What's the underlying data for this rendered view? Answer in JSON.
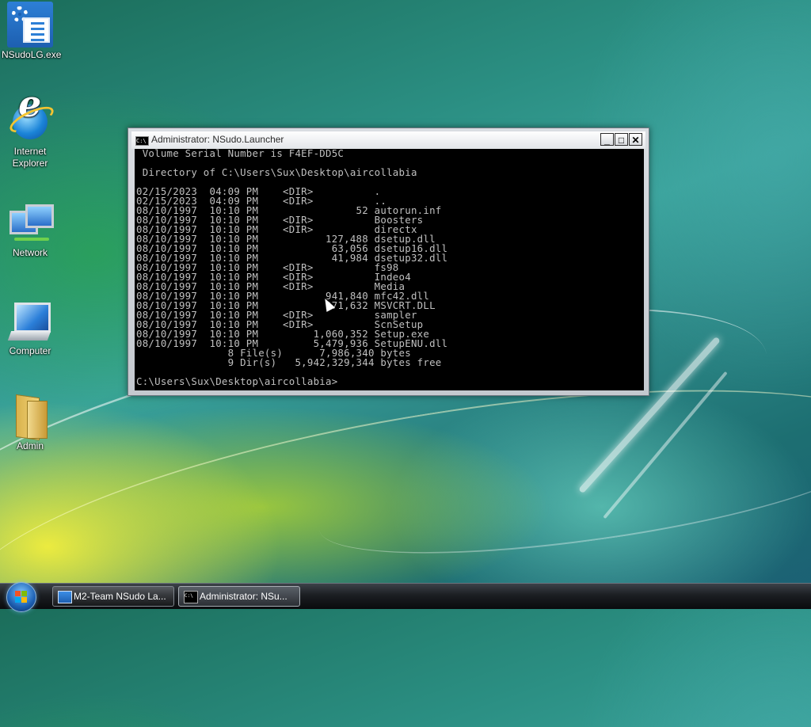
{
  "desktop": {
    "icons": [
      {
        "label": "NSudoLG.exe",
        "icon": "nsudo-icon"
      },
      {
        "label": "Internet Explorer",
        "icon": "internet-explorer-icon"
      },
      {
        "label": "Network",
        "icon": "network-icon"
      },
      {
        "label": "Computer",
        "icon": "computer-icon"
      },
      {
        "label": "Admin",
        "icon": "user-folder-icon"
      }
    ]
  },
  "window": {
    "title": "Administrator: NSudo.Launcher",
    "icon_text": "C:\\",
    "buttons": {
      "minimize": "_",
      "maximize": "□",
      "close": "✕"
    },
    "console_lines": [
      " Volume Serial Number is F4EF-DD5C",
      "",
      " Directory of C:\\Users\\Sux\\Desktop\\aircollabia",
      "",
      "02/15/2023  04:09 PM    <DIR>          .",
      "02/15/2023  04:09 PM    <DIR>          ..",
      "08/10/1997  10:10 PM                52 autorun.inf",
      "08/10/1997  10:10 PM    <DIR>          Boosters",
      "08/10/1997  10:10 PM    <DIR>          directx",
      "08/10/1997  10:10 PM           127,488 dsetup.dll",
      "08/10/1997  10:10 PM            63,056 dsetup16.dll",
      "08/10/1997  10:10 PM            41,984 dsetup32.dll",
      "08/10/1997  10:10 PM    <DIR>          fs98",
      "08/10/1997  10:10 PM    <DIR>          Indeo4",
      "08/10/1997  10:10 PM    <DIR>          Media",
      "08/10/1997  10:10 PM           941,840 mfc42.dll",
      "08/10/1997  10:10 PM           271,632 MSVCRT.DLL",
      "08/10/1997  10:10 PM    <DIR>          sampler",
      "08/10/1997  10:10 PM    <DIR>          ScnSetup",
      "08/10/1997  10:10 PM         1,060,352 Setup.exe",
      "08/10/1997  10:10 PM         5,479,936 SetupENU.dll",
      "               8 File(s)      7,986,340 bytes",
      "               9 Dir(s)   5,942,329,344 bytes free",
      "",
      "C:\\Users\\Sux\\Desktop\\aircollabia>"
    ]
  },
  "taskbar": {
    "tasks": [
      {
        "label": "M2-Team NSudo La...",
        "active": false
      },
      {
        "label": "Administrator: NSu...",
        "active": true
      }
    ]
  }
}
